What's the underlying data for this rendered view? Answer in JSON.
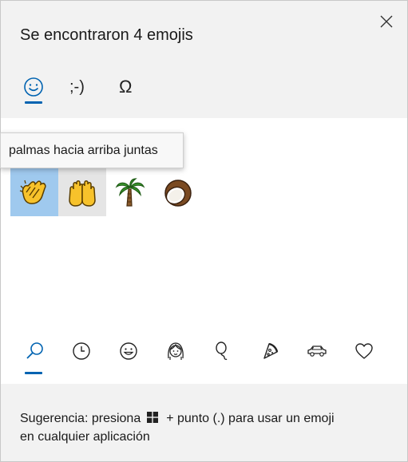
{
  "header": {
    "title": "Se encontraron 4 emojis",
    "close_icon": "close-icon"
  },
  "tabs": [
    {
      "name": "emoji",
      "icon": "smiley-icon",
      "selected": true
    },
    {
      "name": "kaomoji",
      "label": ";-)",
      "selected": false
    },
    {
      "name": "symbols",
      "label": "Ω",
      "selected": false
    }
  ],
  "tooltip": {
    "text": "palmas hacia arriba juntas"
  },
  "results": [
    {
      "icon": "clapping-hands-emoji",
      "state": "selected"
    },
    {
      "icon": "palms-up-together-emoji",
      "state": "hover"
    },
    {
      "icon": "palm-tree-emoji",
      "state": "normal"
    },
    {
      "icon": "coconut-emoji",
      "state": "normal"
    }
  ],
  "categories": [
    {
      "icon": "search-icon",
      "selected": true
    },
    {
      "icon": "clock-icon",
      "selected": false
    },
    {
      "icon": "smiley-face-icon",
      "selected": false
    },
    {
      "icon": "person-icon",
      "selected": false
    },
    {
      "icon": "balloon-icon",
      "selected": false
    },
    {
      "icon": "pizza-icon",
      "selected": false
    },
    {
      "icon": "car-icon",
      "selected": false
    },
    {
      "icon": "heart-icon",
      "selected": false
    }
  ],
  "footer": {
    "hint_part1": "Sugerencia: presiona",
    "hint_part2": "+ punto (.) para usar un emoji",
    "hint_part3": "en cualquier aplicación",
    "windows_icon": "windows-logo-icon"
  },
  "colors": {
    "accent": "#0063b1",
    "selected_bg": "#9fc9ee",
    "hover_bg": "#e5e5e5",
    "panel_bg": "#f2f2f2",
    "content_bg": "#ffffff"
  }
}
